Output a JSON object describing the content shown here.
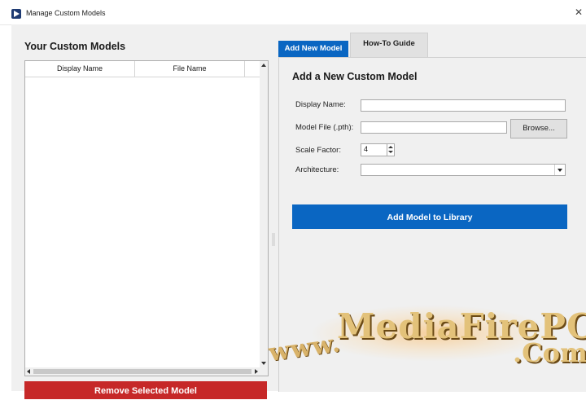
{
  "window": {
    "title": "Manage Custom Models",
    "close_glyph": "✕"
  },
  "left": {
    "section_title": "Your Custom Models",
    "columns": [
      "Display Name",
      "File Name",
      ""
    ],
    "remove_button": "Remove Selected Model"
  },
  "right": {
    "tabs": [
      {
        "label": "Add New Model",
        "active": true
      },
      {
        "label": "How-To Guide",
        "active": false
      }
    ],
    "form_title": "Add a New Custom Model",
    "fields": {
      "display_name_label": "Display Name:",
      "display_name_value": "",
      "model_file_label": "Model File (.pth):",
      "model_file_value": "",
      "browse_label": "Browse...",
      "scale_factor_label": "Scale Factor:",
      "scale_factor_value": "4",
      "architecture_label": "Architecture:",
      "architecture_value": ""
    },
    "add_button": "Add Model to Library"
  },
  "watermark": {
    "www": "www.",
    "main": "MediaFirePC",
    "com": ".Com"
  },
  "colors": {
    "accent": "#0a66c2",
    "danger": "#c62828",
    "panel": "#f0f0f0"
  },
  "icons": {
    "app": "play-icon",
    "close": "close-icon",
    "spin": "spinner-arrows-icon",
    "dropdown": "chevron-down-icon"
  }
}
